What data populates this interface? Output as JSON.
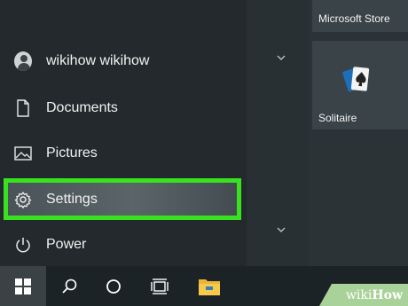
{
  "start_menu": {
    "user": {
      "name": "wikihow wikihow"
    },
    "items": [
      {
        "label": "Documents",
        "icon": "document-icon"
      },
      {
        "label": "Pictures",
        "icon": "pictures-icon"
      },
      {
        "label": "Settings",
        "icon": "gear-icon"
      },
      {
        "label": "Power",
        "icon": "power-icon"
      }
    ],
    "highlight_color": "#38e21e"
  },
  "tiles": {
    "store": {
      "label": "Microsoft Store"
    },
    "solitaire": {
      "label": "Solitaire"
    }
  },
  "taskbar": {
    "buttons": [
      "windows-logo-icon",
      "search-icon",
      "cortana-icon",
      "task-view-icon",
      "file-explorer-icon"
    ]
  },
  "watermark": {
    "wiki": "wiki",
    "how": "How"
  }
}
